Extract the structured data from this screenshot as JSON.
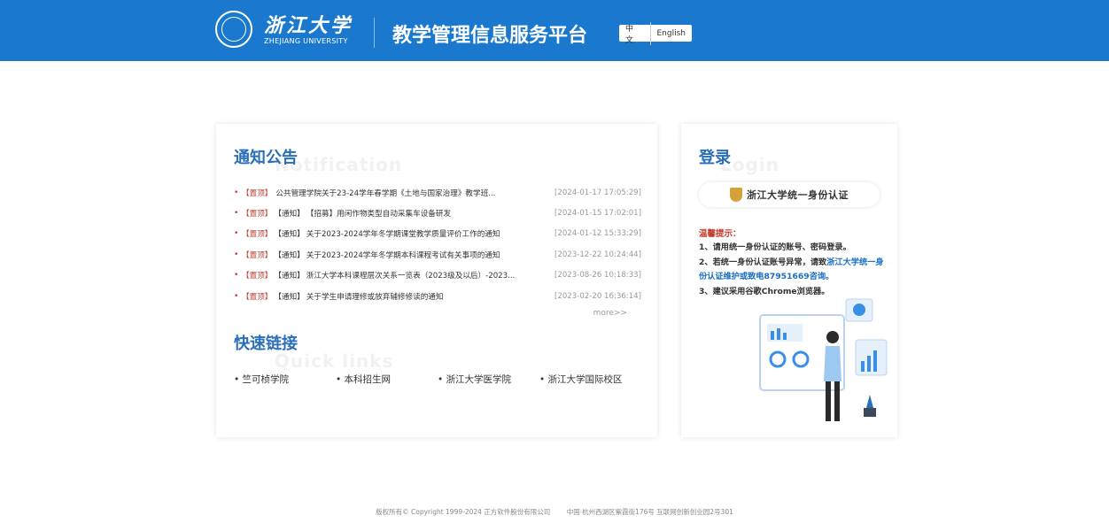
{
  "header": {
    "logo_cn": "浙江大学",
    "logo_en": "ZHEJIANG UNIVERSITY",
    "title": "教学管理信息服务平台",
    "lang": {
      "zh": "中 文",
      "en": "English"
    }
  },
  "notices": {
    "title": "通知公告",
    "watermark": "Notification",
    "items": [
      {
        "top": "【置顶】",
        "type": "",
        "text": "公共管理学院关于23-24学年春学期《土地与国家治理》教学班...",
        "date": "[2024-01-17 17:05:29]"
      },
      {
        "top": "【置顶】",
        "type": "【通知】",
        "text": "【招募】用闲作物类型自动采集车设备研发",
        "date": "[2024-01-15 17:02:01]"
      },
      {
        "top": "【置顶】",
        "type": "【通知】",
        "text": "关于2023-2024学年冬学期课堂教学质量评价工作的通知",
        "date": "[2024-01-12 15:33:29]"
      },
      {
        "top": "【置顶】",
        "type": "【通知】",
        "text": "关于2023-2024学年冬学期本科课程考试有关事项的通知",
        "date": "[2023-12-22 10:24:44]"
      },
      {
        "top": "【置顶】",
        "type": "【通知】",
        "text": "浙江大学本科课程层次关系一览表（2023级及以后）-2023...",
        "date": "[2023-08-26 10:18:33]"
      },
      {
        "top": "【置顶】",
        "type": "【通知】",
        "text": "关于学生申请理修或放弃辅修修读的通知",
        "date": "[2023-02-20 16:36:14]"
      }
    ],
    "more": "more>>"
  },
  "quick_links": {
    "title": "快速链接",
    "watermark": "Quick links",
    "items": [
      "• 竺可桢学院",
      "• 本科招生网",
      "• 浙江大学医学院",
      "• 浙江大学国际校区"
    ]
  },
  "login": {
    "title": "登录",
    "watermark": "Login",
    "cas_label": "浙江大学统一身份认证",
    "tips_title": "温馨提示：",
    "tip1": "1、请用统一身份认证的账号、密码登录。",
    "tip2_pre": "2、若统一身份认证账号异常，请致",
    "tip2_link": "浙江大学统一身份认证维护或致电87951669咨询。",
    "tip3": "3、建议采用谷歌Chrome浏览器。"
  },
  "footer": {
    "copyright": "版权所有© Copyright 1999-2024 正方软件股份有限公司",
    "address": "中国·杭州西湖区紫霞街176号 互联网创新创业园2号301"
  },
  "colors": {
    "header": "#1a79cf",
    "accent_red": "#c0392b",
    "title_blue": "#2a6fb8"
  }
}
